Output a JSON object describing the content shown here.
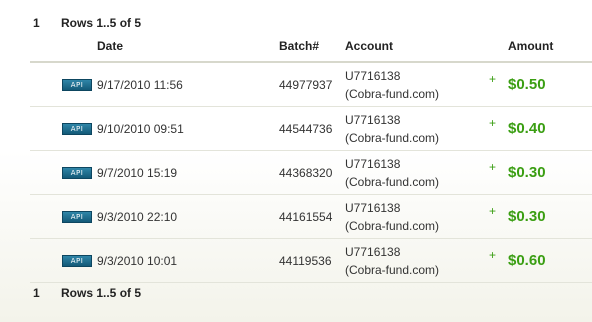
{
  "pager_top": {
    "page": "1",
    "label": "Rows 1..5 of 5"
  },
  "columns": {
    "date": "Date",
    "batch": "Batch#",
    "account": "Account",
    "amount": "Amount"
  },
  "rows": [
    {
      "badge": "API",
      "date": "9/17/2010 11:56",
      "batch": "44977937",
      "account_id": "U7716138",
      "account_name": "(Cobra-fund.com)",
      "sign": "+",
      "amount": "$0.50"
    },
    {
      "badge": "API",
      "date": "9/10/2010 09:51",
      "batch": "44544736",
      "account_id": "U7716138",
      "account_name": "(Cobra-fund.com)",
      "sign": "+",
      "amount": "$0.40"
    },
    {
      "badge": "API",
      "date": "9/7/2010 15:19",
      "batch": "44368320",
      "account_id": "U7716138",
      "account_name": "(Cobra-fund.com)",
      "sign": "+",
      "amount": "$0.30"
    },
    {
      "badge": "API",
      "date": "9/3/2010 22:10",
      "batch": "44161554",
      "account_id": "U7716138",
      "account_name": "(Cobra-fund.com)",
      "sign": "+",
      "amount": "$0.30"
    },
    {
      "badge": "API",
      "date": "9/3/2010 10:01",
      "batch": "44119536",
      "account_id": "U7716138",
      "account_name": "(Cobra-fund.com)",
      "sign": "+",
      "amount": "$0.60"
    }
  ],
  "pager_bottom": {
    "page": "1",
    "label": "Rows 1..5 of 5"
  },
  "colors": {
    "amount_green": "#3a9e12",
    "badge_blue": "#1f6f90"
  }
}
